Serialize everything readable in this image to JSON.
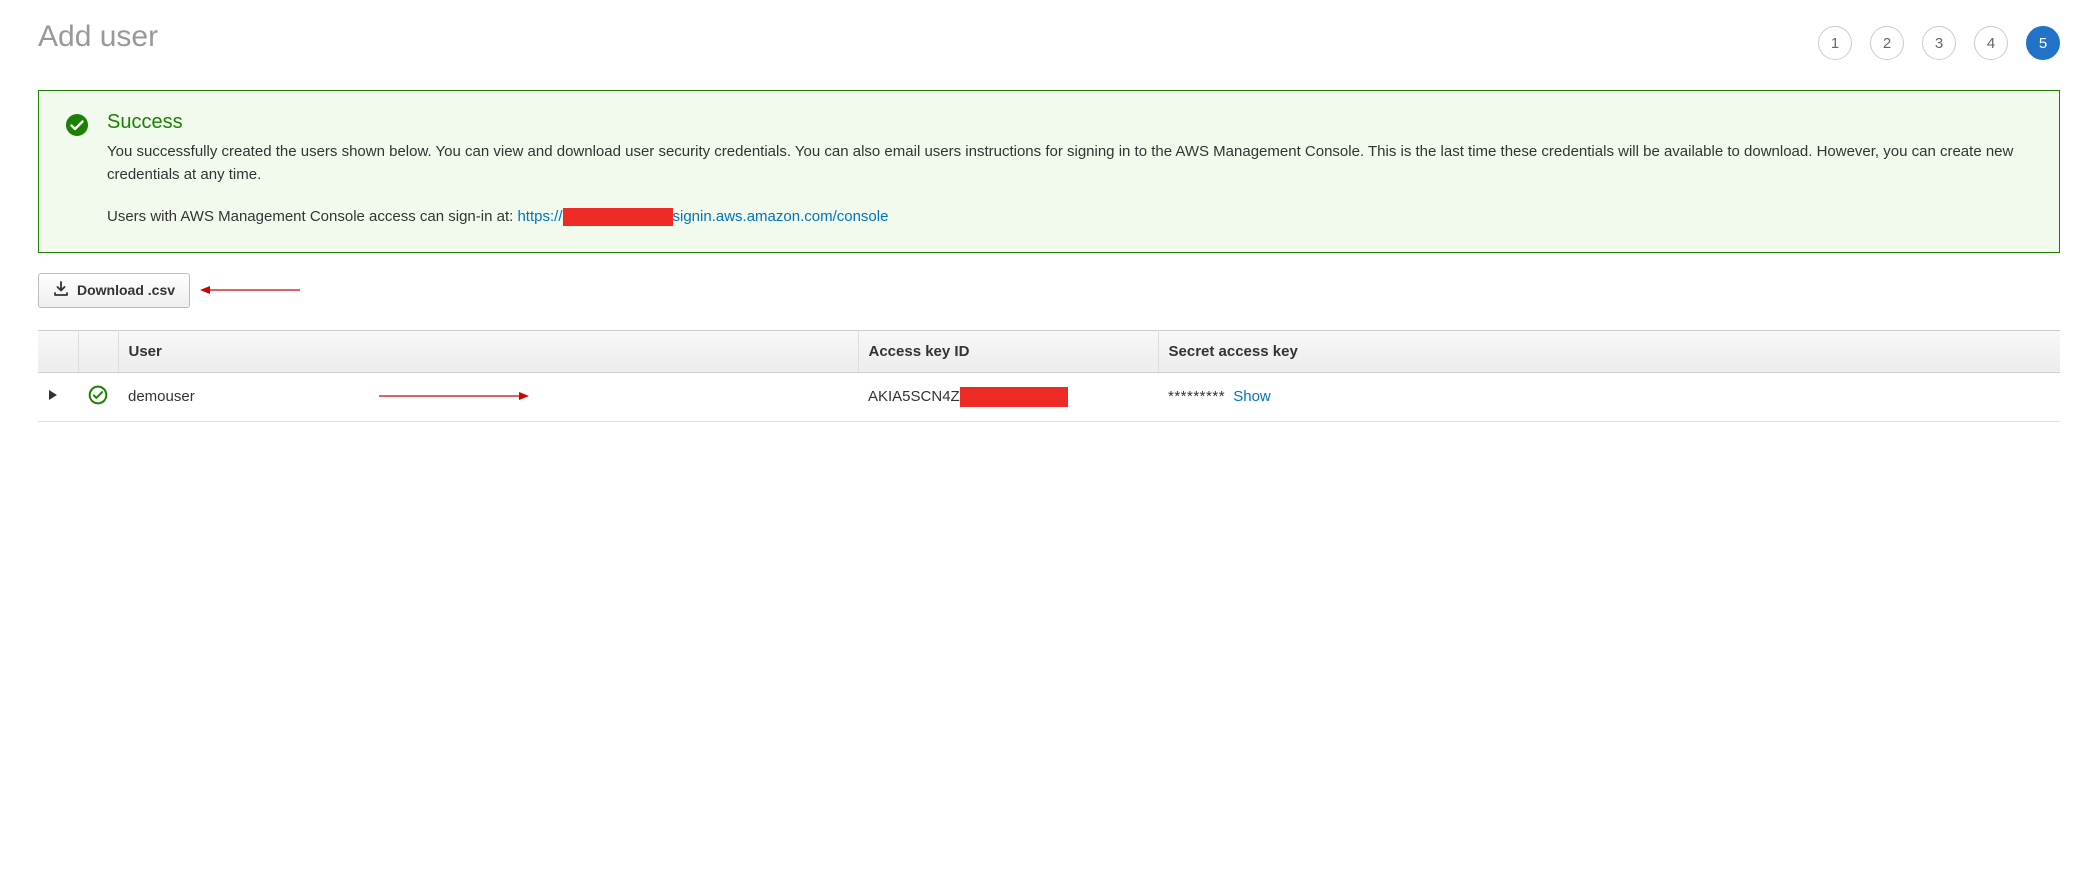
{
  "header": {
    "title": "Add user",
    "steps": [
      "1",
      "2",
      "3",
      "4",
      "5"
    ],
    "active_step_index": 4
  },
  "alert": {
    "title": "Success",
    "body": "You successfully created the users shown below. You can view and download user security credentials. You can also email users instructions for signing in to the AWS Management Console. This is the last time these credentials will be available to download. However, you can create new credentials at any time.",
    "signin_prefix": "Users with AWS Management Console access can sign-in at: ",
    "signin_url_prefix": "https://",
    "signin_url_suffix": "signin.aws.amazon.com/console"
  },
  "download_button_label": "Download .csv",
  "table": {
    "columns": {
      "user": "User",
      "access_key_id": "Access key ID",
      "secret_access_key": "Secret access key"
    },
    "rows": [
      {
        "username": "demouser",
        "access_key_id_visible": "AKIA5SCN4Z",
        "secret_masked": "*********",
        "show_label": "Show"
      }
    ]
  }
}
